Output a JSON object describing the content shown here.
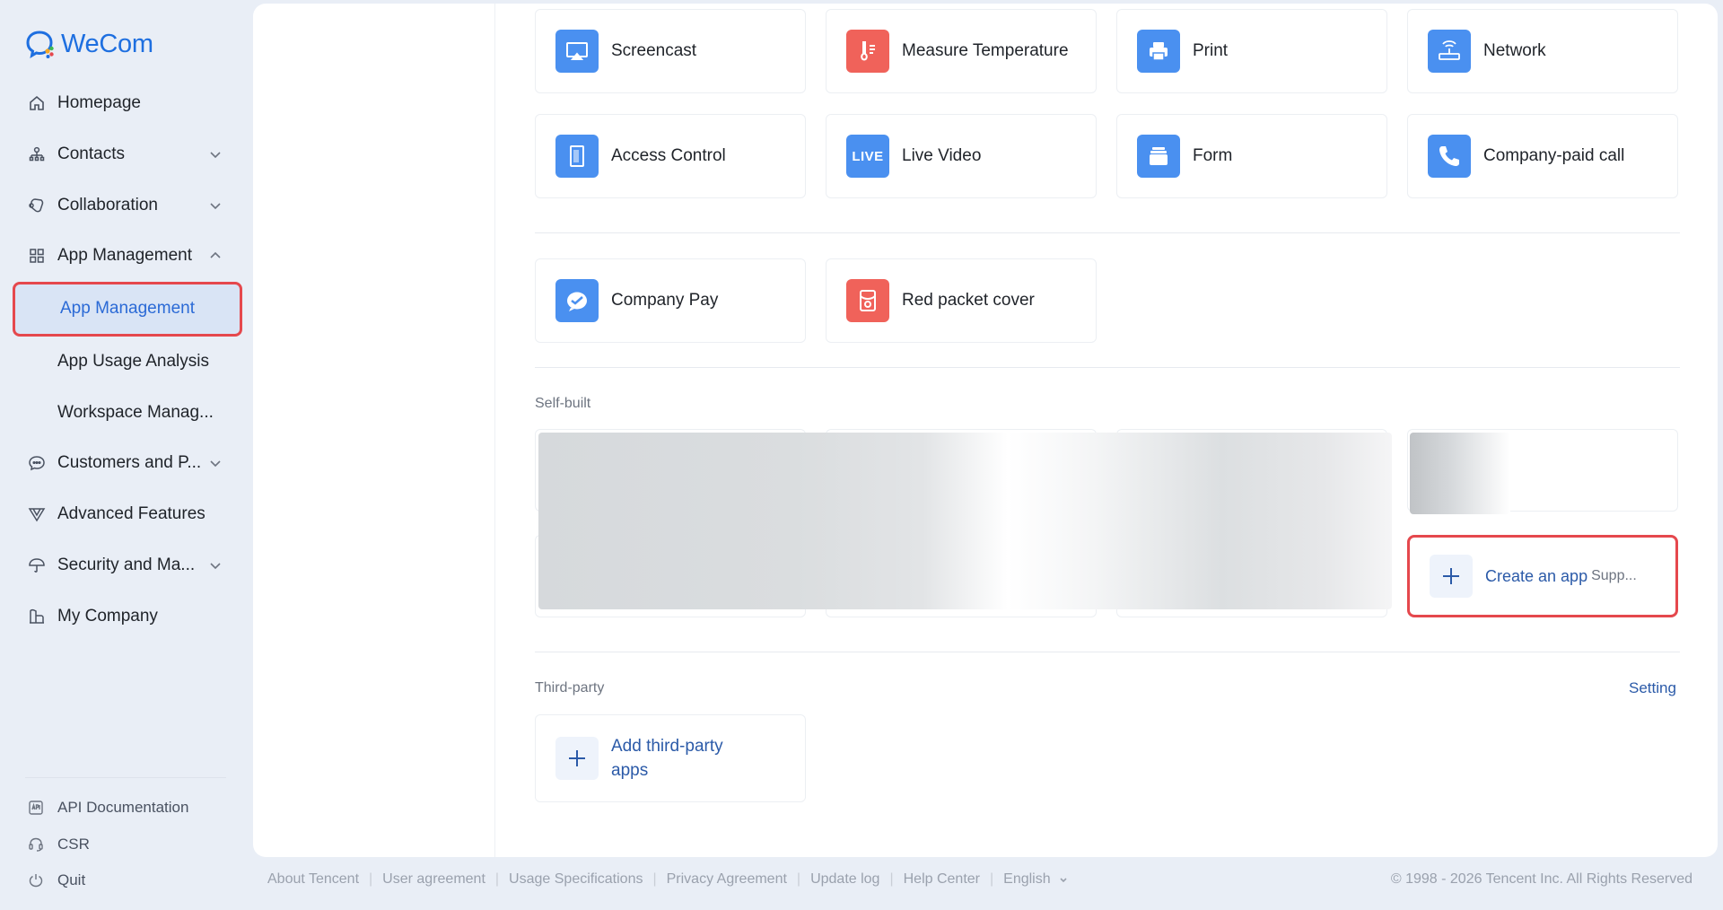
{
  "app": {
    "name": "WeCom"
  },
  "sidebar": {
    "items": [
      {
        "label": "Homepage"
      },
      {
        "label": "Contacts"
      },
      {
        "label": "Collaboration"
      },
      {
        "label": "App Management"
      },
      {
        "label": "App Management"
      },
      {
        "label": "App Usage Analysis"
      },
      {
        "label": "Workspace Manag..."
      },
      {
        "label": "Customers and P..."
      },
      {
        "label": "Advanced Features"
      },
      {
        "label": "Security and Ma..."
      },
      {
        "label": "My Company"
      }
    ],
    "bottom": [
      {
        "label": "API Documentation"
      },
      {
        "label": "CSR"
      },
      {
        "label": "Quit"
      }
    ]
  },
  "apps": {
    "row1": [
      {
        "label": "Screencast",
        "color": "#4a90f0"
      },
      {
        "label": "Measure Temperature",
        "color": "#f0625a"
      },
      {
        "label": "Print",
        "color": "#4a90f0"
      },
      {
        "label": "Network",
        "color": "#4a90f0"
      }
    ],
    "row2": [
      {
        "label": "Access Control",
        "color": "#4a90f0"
      },
      {
        "label": "Live Video",
        "color": "#4a90f0",
        "badge": "LIVE"
      },
      {
        "label": "Form",
        "color": "#4a90f0"
      },
      {
        "label": "Company-paid call",
        "color": "#4a90f0"
      }
    ],
    "row3": [
      {
        "label": "Company Pay",
        "color": "#4a90f0"
      },
      {
        "label": "Red packet cover",
        "color": "#f0625a"
      }
    ]
  },
  "self_built": {
    "title": "Self-built",
    "create_label": "Create an app",
    "create_sub": "Supp..."
  },
  "third_party": {
    "title": "Third-party",
    "setting_label": "Setting",
    "add_label": "Add third-party apps"
  },
  "footer": {
    "links": [
      "About Tencent",
      "User agreement",
      "Usage Specifications",
      "Privacy Agreement",
      "Update log",
      "Help Center",
      "English"
    ],
    "copyright": "© 1998 - 2026 Tencent Inc. All Rights Reserved"
  }
}
